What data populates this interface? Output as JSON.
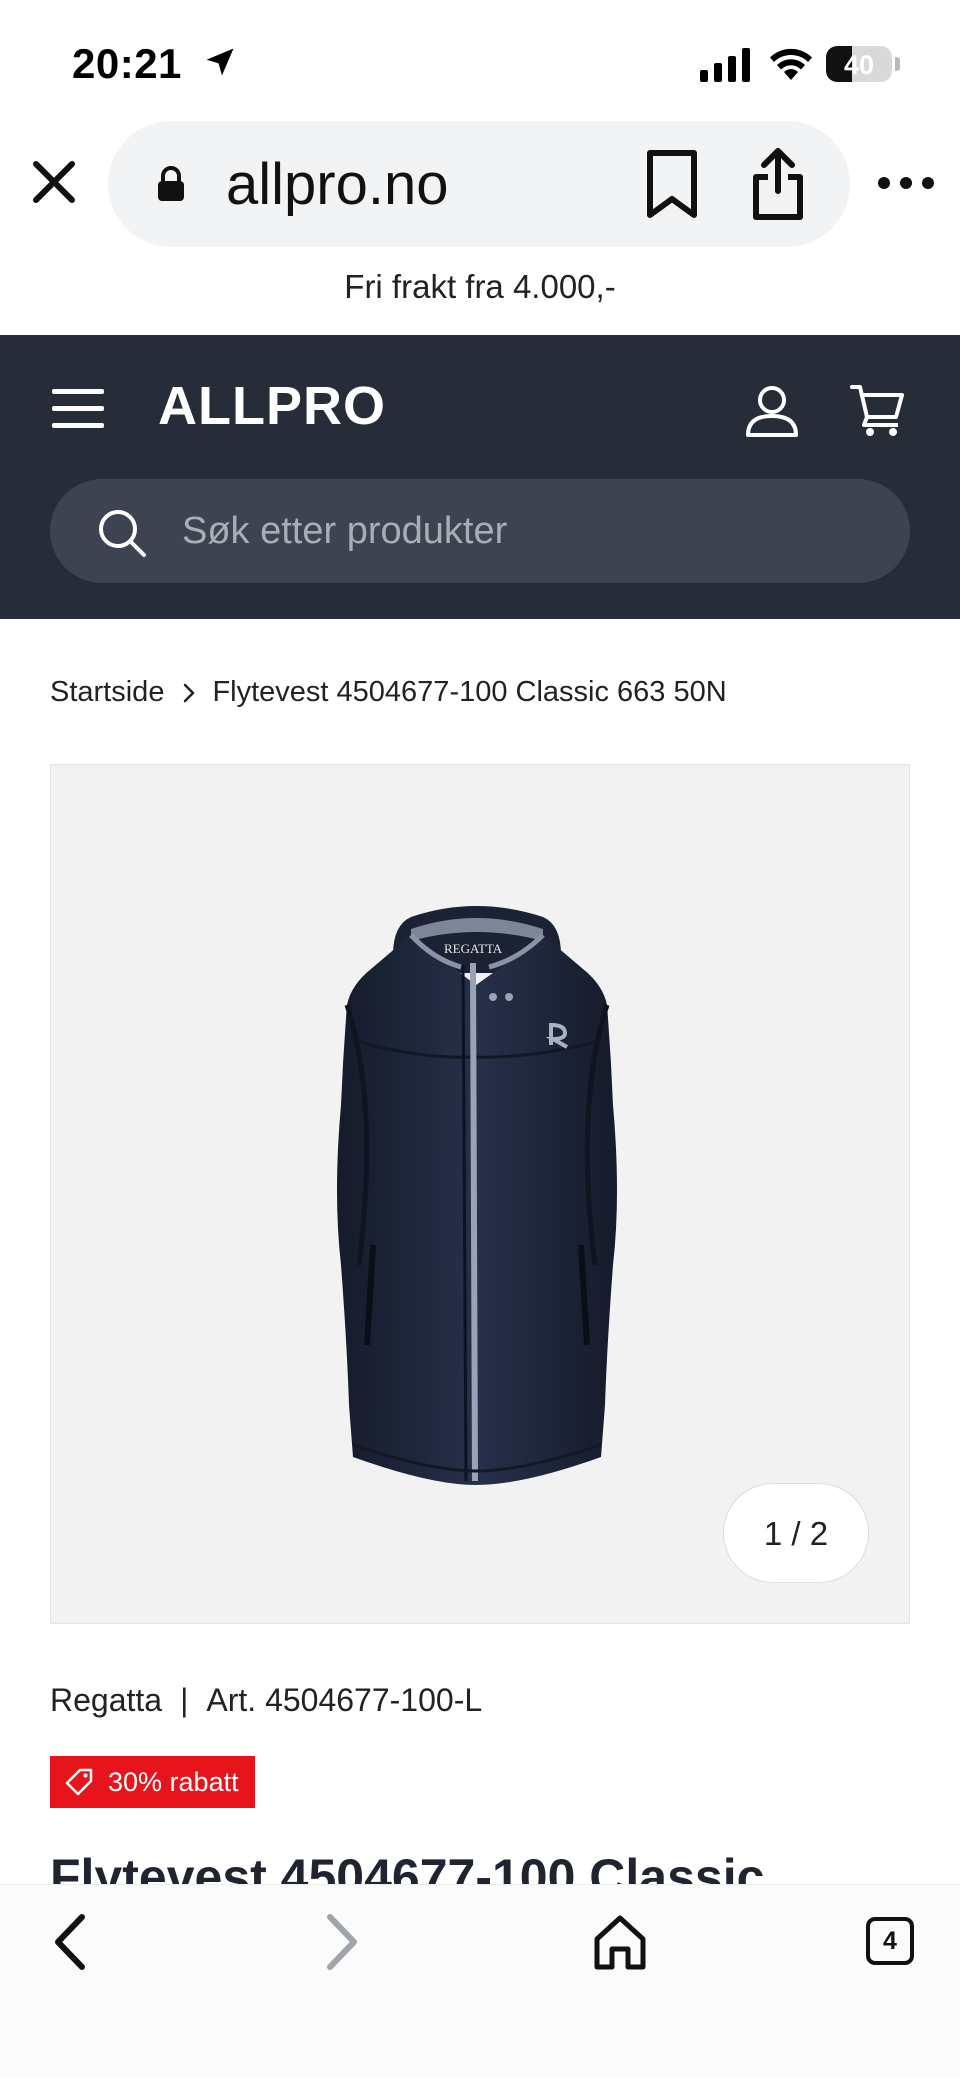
{
  "status_bar": {
    "time": "20:21",
    "battery_level": 40,
    "battery_text": "40"
  },
  "browser": {
    "url": "allpro.no",
    "open_tabs": "4"
  },
  "promo_banner": "Fri frakt fra 4.000,-",
  "header": {
    "logo": "ALLPRO",
    "search_placeholder": "Søk etter produkter"
  },
  "breadcrumb": {
    "home": "Startside",
    "current": "Flytevest 4504677-100 Classic 663 50N"
  },
  "gallery": {
    "counter": "1 / 2",
    "image_logo_text": "REGATTA"
  },
  "product": {
    "brand": "Regatta",
    "separator": "|",
    "article": "Art. 4504677-100-L",
    "discount": "30% rabatt",
    "title": "Flytevest 4504677-100 Classic"
  },
  "colors": {
    "header_bg": "#262c38",
    "search_bg": "#3d4350",
    "discount_bg": "#e8141c",
    "vest_navy": "#1d2436"
  }
}
